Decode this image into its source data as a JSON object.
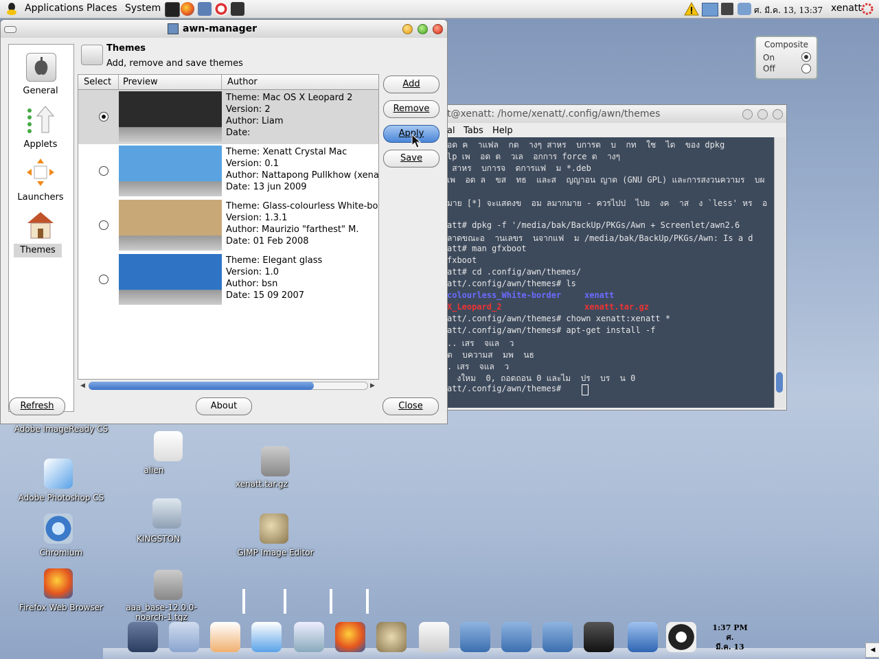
{
  "top_panel": {
    "menus": [
      "Applications",
      "Places",
      "System"
    ],
    "clock": "ศ. มี.ค. 13, 13:37",
    "user": "xenatt"
  },
  "composite": {
    "title": "Composite",
    "on_label": "On",
    "off_label": "Off",
    "selected": "On"
  },
  "awn_window": {
    "title": "awn-manager",
    "sidebar": [
      {
        "label": "General",
        "icon": "apple-icon"
      },
      {
        "label": "Applets",
        "icon": "applets-icon"
      },
      {
        "label": "Launchers",
        "icon": "launchers-icon"
      },
      {
        "label": "Themes",
        "icon": "house-icon",
        "selected": true
      }
    ],
    "section_title": "Themes",
    "section_subtitle": "Add, remove and save themes",
    "columns": [
      "Select",
      "Preview",
      "Author"
    ],
    "themes": [
      {
        "theme": "Theme: Mac OS X Leopard 2",
        "version": "Version: 2",
        "author": "Author: Liam",
        "date": "Date:",
        "selected": true,
        "preview_color": "#2b2b2b"
      },
      {
        "theme": "Theme: Xenatt Crystal Mac",
        "version": "Version: 0.1",
        "author": "Author: Nattapong Pullkhow (xenatt)",
        "date": "Date: 13 jun 2009",
        "selected": false,
        "preview_color": "#5aa3e0"
      },
      {
        "theme": "Theme: Glass-colourless White-border",
        "version": "Version: 1.3.1",
        "author": "Author: Maurizio \"farthest\" M.",
        "date": "Date: 01 Feb 2008",
        "selected": false,
        "preview_color": "#c9a877"
      },
      {
        "theme": "Theme: Elegant glass",
        "version": "Version: 1.0",
        "author": "Author: bsn",
        "date": "Date: 15 09 2007",
        "selected": false,
        "preview_color": "#2f74c4"
      }
    ],
    "buttons": {
      "add": "Add",
      "remove": "Remove",
      "apply": "Apply",
      "save": "Save",
      "refresh": "Refresh",
      "about": "About",
      "close": "Close"
    }
  },
  "terminal": {
    "title": "t@xenatt: /home/xenatt/.config/awn/themes",
    "menus": [
      "al",
      "Tabs",
      "Help"
    ],
    "lines": [
      "อด ค  าแฟล  กต  างๆ สาหร  บการต  บ  กท  ใช  ได  ของ dpkg",
      "lp เพ  อด ต  วเล  อกการ force ต  างๆ",
      " สาหร  บการจ  ดการแฟ  ม *.deb",
      "เพ  อด ล  ขส  ทธ  และส  ญญาอน ญาต (GNU GPL) และการสงวนความร  บผ",
      "",
      "มาย [*] จะแสดงข  อม ลมากมาย - ควรไปป  ไปย  งค  าส  ง `less' หร  อ",
      "",
      "att# dpkg -f '/media/bak/BackUp/PKGs/Awn + Screenlet/awn2.6",
      "ลาดขณะอ  านเลขร  นจากแฟ  ม /media/bak/BackUp/PKGs/Awn: Is a d",
      "att# man gfxboot",
      "fxboot",
      "att# cd .config/awn/themes/",
      "att/.config/awn/themes# ls",
      "",
      "",
      "att/.config/awn/themes# chown xenatt:xenatt *",
      "att/.config/awn/themes# apt-get install -f",
      ".. เสร  จแล  ว",
      "ต  บความส  มพ  นธ  ",
      ". เสร  จแล  ว",
      "  งใหม  0, ถอดถอน 0 และไม  ปร  บร  น 0",
      "att/.config/awn/themes# "
    ],
    "ls_line1_a": "colourless_White-border",
    "ls_line1_b": "xenatt",
    "ls_line2_a": "X_Leopard_2",
    "ls_line2_b": "xenatt.tar.gz"
  },
  "desktop_icons": [
    {
      "label": "Adobe ImageReady CS",
      "icon": "imageready-icon"
    },
    {
      "label": "Adobe Photoshop CS",
      "icon": "photoshop-icon"
    },
    {
      "label": "Chromium",
      "icon": "chromium-icon"
    },
    {
      "label": "Firefox Web Browser",
      "icon": "firefox-icon"
    },
    {
      "label": "alien",
      "icon": "perl-icon"
    },
    {
      "label": "KINGSTON",
      "icon": "usb-drive-icon"
    },
    {
      "label": "aaa_base-12.0.0-noarch-1.tgz",
      "icon": "archive-icon"
    },
    {
      "label": "xenatt.tar.gz",
      "icon": "archive-icon"
    },
    {
      "label": "GIMP Image Editor",
      "icon": "gimp-icon"
    }
  ],
  "dock": {
    "clock_time": "1:37 PM",
    "clock_day": "ศ.",
    "clock_date": "มี.ค. 13",
    "items": [
      "windows-icon",
      "finder-icon",
      "feather-icon",
      "photoshop-icon",
      "search-icon",
      "firefox-icon",
      "gimp-icon",
      "apple-icon",
      "folder-search-icon",
      "folder-search-icon",
      "folder-search-icon",
      "terminal-icon",
      "awn-manager-icon",
      "power-icon"
    ]
  }
}
